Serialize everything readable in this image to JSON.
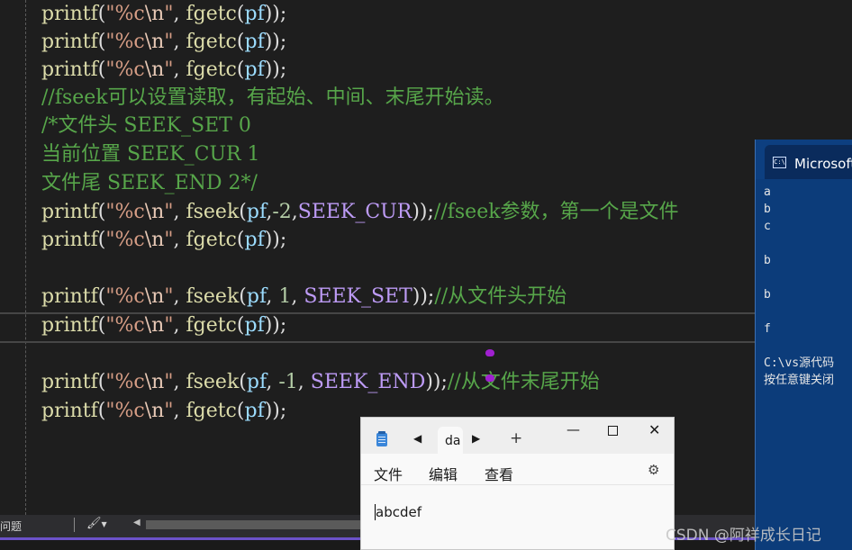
{
  "editor": {
    "lines": [
      [
        {
          "t": "printf",
          "c": "fn"
        },
        {
          "t": "(",
          "c": "pun"
        },
        {
          "t": "\"%c",
          "c": "str"
        },
        {
          "t": "\\n",
          "c": "esc"
        },
        {
          "t": "\"",
          "c": "str"
        },
        {
          "t": ", ",
          "c": "pun"
        },
        {
          "t": "fgetc",
          "c": "fn"
        },
        {
          "t": "(",
          "c": "pun"
        },
        {
          "t": "pf",
          "c": "id"
        },
        {
          "t": "));",
          "c": "pun"
        }
      ],
      [
        {
          "t": "printf",
          "c": "fn"
        },
        {
          "t": "(",
          "c": "pun"
        },
        {
          "t": "\"%c",
          "c": "str"
        },
        {
          "t": "\\n",
          "c": "esc"
        },
        {
          "t": "\"",
          "c": "str"
        },
        {
          "t": ", ",
          "c": "pun"
        },
        {
          "t": "fgetc",
          "c": "fn"
        },
        {
          "t": "(",
          "c": "pun"
        },
        {
          "t": "pf",
          "c": "id"
        },
        {
          "t": "));",
          "c": "pun"
        }
      ],
      [
        {
          "t": "printf",
          "c": "fn"
        },
        {
          "t": "(",
          "c": "pun"
        },
        {
          "t": "\"%c",
          "c": "str"
        },
        {
          "t": "\\n",
          "c": "esc"
        },
        {
          "t": "\"",
          "c": "str"
        },
        {
          "t": ", ",
          "c": "pun"
        },
        {
          "t": "fgetc",
          "c": "fn"
        },
        {
          "t": "(",
          "c": "pun"
        },
        {
          "t": "pf",
          "c": "id"
        },
        {
          "t": "));",
          "c": "pun"
        }
      ],
      [
        {
          "t": "//fseek可以设置读取，有起始、中间、末尾开始读。",
          "c": "cmt"
        }
      ],
      [
        {
          "t": "/*文件头 SEEK_SET 0",
          "c": "cmt"
        }
      ],
      [
        {
          "t": "当前位置 SEEK_CUR 1",
          "c": "cmt"
        }
      ],
      [
        {
          "t": "文件尾 SEEK_END 2*/",
          "c": "cmt"
        }
      ],
      [
        {
          "t": "printf",
          "c": "fn"
        },
        {
          "t": "(",
          "c": "pun"
        },
        {
          "t": "\"%c",
          "c": "str"
        },
        {
          "t": "\\n",
          "c": "esc"
        },
        {
          "t": "\"",
          "c": "str"
        },
        {
          "t": ", ",
          "c": "pun"
        },
        {
          "t": "fseek",
          "c": "fn"
        },
        {
          "t": "(",
          "c": "pun"
        },
        {
          "t": "pf",
          "c": "id"
        },
        {
          "t": ",",
          "c": "pun"
        },
        {
          "t": "-2",
          "c": "num"
        },
        {
          "t": ",",
          "c": "pun"
        },
        {
          "t": "SEEK_CUR",
          "c": "mac"
        },
        {
          "t": "));",
          "c": "pun"
        },
        {
          "t": "//fseek参数，第一个是文件",
          "c": "cmt"
        }
      ],
      [
        {
          "t": "printf",
          "c": "fn"
        },
        {
          "t": "(",
          "c": "pun"
        },
        {
          "t": "\"%c",
          "c": "str"
        },
        {
          "t": "\\n",
          "c": "esc"
        },
        {
          "t": "\"",
          "c": "str"
        },
        {
          "t": ", ",
          "c": "pun"
        },
        {
          "t": "fgetc",
          "c": "fn"
        },
        {
          "t": "(",
          "c": "pun"
        },
        {
          "t": "pf",
          "c": "id"
        },
        {
          "t": "));",
          "c": "pun"
        }
      ],
      [],
      [
        {
          "t": "printf",
          "c": "fn"
        },
        {
          "t": "(",
          "c": "pun"
        },
        {
          "t": "\"%c",
          "c": "str"
        },
        {
          "t": "\\n",
          "c": "esc"
        },
        {
          "t": "\"",
          "c": "str"
        },
        {
          "t": ", ",
          "c": "pun"
        },
        {
          "t": "fseek",
          "c": "fn"
        },
        {
          "t": "(",
          "c": "pun"
        },
        {
          "t": "pf",
          "c": "id"
        },
        {
          "t": ", ",
          "c": "pun"
        },
        {
          "t": "1",
          "c": "num"
        },
        {
          "t": ", ",
          "c": "pun"
        },
        {
          "t": "SEEK_SET",
          "c": "mac"
        },
        {
          "t": "));",
          "c": "pun"
        },
        {
          "t": "//从文件头开始",
          "c": "cmt"
        }
      ],
      [
        {
          "t": "printf",
          "c": "fn"
        },
        {
          "t": "(",
          "c": "pun"
        },
        {
          "t": "\"%c",
          "c": "str"
        },
        {
          "t": "\\n",
          "c": "esc"
        },
        {
          "t": "\"",
          "c": "str"
        },
        {
          "t": ", ",
          "c": "pun"
        },
        {
          "t": "fgetc",
          "c": "fn"
        },
        {
          "t": "(",
          "c": "pun"
        },
        {
          "t": "pf",
          "c": "id"
        },
        {
          "t": "));",
          "c": "pun"
        }
      ],
      [],
      [
        {
          "t": "printf",
          "c": "fn"
        },
        {
          "t": "(",
          "c": "pun"
        },
        {
          "t": "\"%c",
          "c": "str"
        },
        {
          "t": "\\n",
          "c": "esc"
        },
        {
          "t": "\"",
          "c": "str"
        },
        {
          "t": ", ",
          "c": "pun"
        },
        {
          "t": "fseek",
          "c": "fn"
        },
        {
          "t": "(",
          "c": "pun"
        },
        {
          "t": "pf",
          "c": "id"
        },
        {
          "t": ", ",
          "c": "pun"
        },
        {
          "t": "-1",
          "c": "num"
        },
        {
          "t": ", ",
          "c": "pun"
        },
        {
          "t": "SEEK_END",
          "c": "mac"
        },
        {
          "t": "));",
          "c": "pun"
        },
        {
          "t": "//从文件末尾开始",
          "c": "cmt"
        }
      ],
      [
        {
          "t": "printf",
          "c": "fn"
        },
        {
          "t": "(",
          "c": "pun"
        },
        {
          "t": "\"%c",
          "c": "str"
        },
        {
          "t": "\\n",
          "c": "esc"
        },
        {
          "t": "\"",
          "c": "str"
        },
        {
          "t": ", ",
          "c": "pun"
        },
        {
          "t": "fgetc",
          "c": "fn"
        },
        {
          "t": "(",
          "c": "pun"
        },
        {
          "t": "pf",
          "c": "id"
        },
        {
          "t": "));",
          "c": "pun"
        }
      ]
    ]
  },
  "statusbar": {
    "issues_label": "问题",
    "brush_icon": "paintbrush-icon",
    "dropdown_icon": "chevron-down-icon"
  },
  "console": {
    "title": "Microsoft",
    "icon": "cmd-icon",
    "output": "a\nb\nc\n\nb\n\nb\n\nf\n\nC:\\vs源代码\n按任意键关闭"
  },
  "notepad": {
    "tab_label": "da",
    "menu": [
      "文件",
      "编辑",
      "查看"
    ],
    "content": "abcdef",
    "icons": {
      "app": "notepad-icon",
      "back": "chevron-left-icon",
      "forward": "chevron-right-icon",
      "add": "plus-icon",
      "minimize": "minimize-icon",
      "maximize": "maximize-icon",
      "close": "close-icon",
      "settings": "gear-icon"
    }
  },
  "watermark": "CSDN @阿祥成长日记",
  "colors": {
    "editor_bg": "#1e1e1e",
    "function": "#dcdcaa",
    "string": "#d69d85",
    "identifier": "#9cdcfe",
    "macro": "#bd9bf5",
    "comment": "#57a64a",
    "console_bg": "#0c3c7a",
    "accent": "#6c52c9"
  }
}
